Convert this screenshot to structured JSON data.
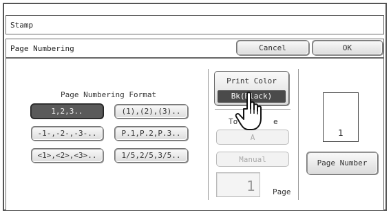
{
  "header": {
    "title": "Stamp"
  },
  "subheader": {
    "title": "Page Numbering",
    "cancel_label": "Cancel",
    "ok_label": "OK"
  },
  "format": {
    "label": "Page Numbering Format",
    "options": [
      "1,2,3..",
      "(1),(2),(3)..",
      "-1-,-2-,-3-..",
      "P.1,P.2,P.3..",
      "<1>,<2>,<3>..",
      "1/5,2/5,3/5.."
    ],
    "selected": "1,2,3.."
  },
  "print_color": {
    "label": "Print Color",
    "value": "Bk(Black)"
  },
  "total_page": {
    "label_visible_left": "Tota",
    "label_visible_right": "e",
    "auto_label": "A",
    "manual_label": "Manual",
    "page_value": "1",
    "page_unit": "Page"
  },
  "preview": {
    "page_number": "1",
    "button_label": "Page Number"
  },
  "icons": {
    "pointer": "hand-pointer-icon"
  },
  "colors": {
    "selected": "#5a5a5a",
    "print_color_value_bg": "#4a4a4a"
  }
}
